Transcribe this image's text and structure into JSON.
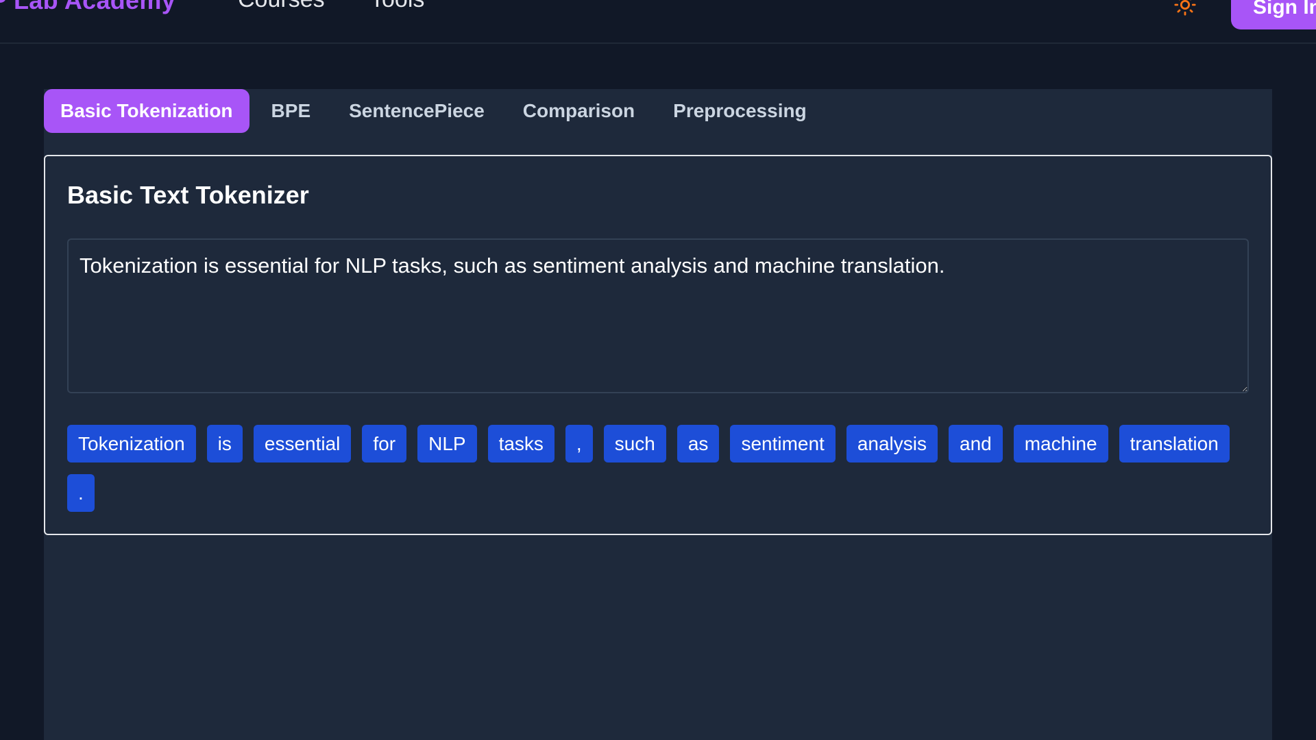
{
  "header": {
    "brand": "P Lab Academy",
    "nav": {
      "courses": "Courses",
      "tools": "Tools"
    },
    "theme_icon": "sun-icon",
    "signin_label": "Sign In"
  },
  "tabs": [
    {
      "label": "Basic Tokenization",
      "active": true
    },
    {
      "label": "BPE",
      "active": false
    },
    {
      "label": "SentencePiece",
      "active": false
    },
    {
      "label": "Comparison",
      "active": false
    },
    {
      "label": "Preprocessing",
      "active": false
    }
  ],
  "card": {
    "title": "Basic Text Tokenizer",
    "input_value": "Tokenization is essential for NLP tasks, such as sentiment analysis and machine translation."
  },
  "tokens": [
    "Tokenization",
    "is",
    "essential",
    "for",
    "NLP",
    "tasks",
    ",",
    "such",
    "as",
    "sentiment",
    "analysis",
    "and",
    "machine",
    "translation",
    "."
  ],
  "colors": {
    "accent": "#a855f7",
    "token_bg": "#1d4ed8",
    "page_bg": "#111827",
    "panel_bg": "#1e293b",
    "sun": "#f97316"
  }
}
